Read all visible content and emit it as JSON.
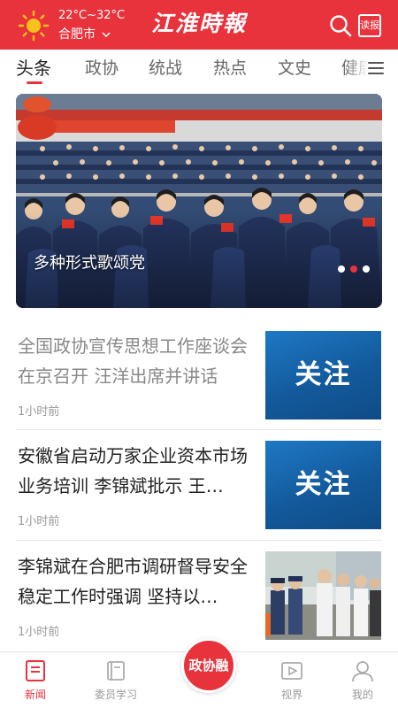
{
  "header": {
    "weather_temp": "22°C~32°C",
    "city": "合肥市",
    "city_dropdown_icon": "chevron-down",
    "logo_text": "江淮時報",
    "search_icon": "search",
    "read_label": "读报"
  },
  "tabs": {
    "items": [
      {
        "label": "头条",
        "active": true
      },
      {
        "label": "政协"
      },
      {
        "label": "统战"
      },
      {
        "label": "热点"
      },
      {
        "label": "文史"
      },
      {
        "label": "健康"
      }
    ],
    "menu_icon": "menu"
  },
  "banner": {
    "caption": "多种形式歌颂党",
    "slide_count": 3,
    "active_slide": 2
  },
  "news": [
    {
      "title": "全国政协宣传思想工作座谈会在京召开 汪洋出席并讲话",
      "time": "1小时前",
      "thumb_text": "关注",
      "read": true
    },
    {
      "title": "安徽省启动万家企业资本市场业务培训 李锦斌批示 王…",
      "time": "1小时前",
      "thumb_text": "关注",
      "read": false
    },
    {
      "title": "李锦斌在合肥市调研督导安全稳定工作时强调 坚持以…",
      "time": "1小时前",
      "thumb_text": "",
      "read": false
    }
  ],
  "bottom_nav": {
    "items": [
      {
        "label": "新闻",
        "icon": "news-icon",
        "active": true
      },
      {
        "label": "委员学习",
        "icon": "book-icon"
      },
      {
        "label": "视界",
        "icon": "video-icon"
      },
      {
        "label": "我的",
        "icon": "user-icon"
      }
    ],
    "center_label": "政协融"
  },
  "colors": {
    "brand_red": "#e8333c",
    "follow_blue": "#1566ad",
    "sun_yellow": "#f7c21b"
  }
}
